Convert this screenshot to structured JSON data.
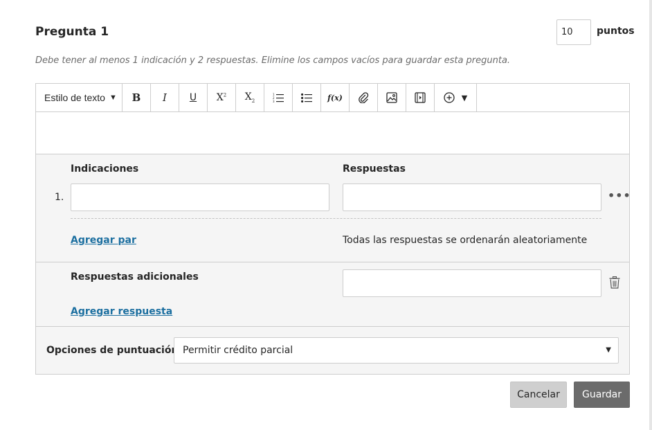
{
  "question": {
    "title": "Pregunta 1",
    "points_value": "10",
    "points_label": "puntos",
    "hint": "Debe tener al menos 1 indicación y 2 respuestas. Elimine los campos vacíos para guardar esta pregunta."
  },
  "toolbar": {
    "text_style": "Estilo de texto",
    "bold": "B",
    "italic": "I",
    "underline": "U",
    "superscript_base": "X",
    "subscript_base": "X",
    "formula": "f(x)"
  },
  "pairs": {
    "prompts_header": "Indicaciones",
    "answers_header": "Respuestas",
    "rows": [
      {
        "number": "1.",
        "prompt": "",
        "answer": ""
      }
    ],
    "add_pair": "Agregar par",
    "randomize_note": "Todas las respuestas se ordenarán aleatoriamente"
  },
  "additional": {
    "header": "Respuestas adicionales",
    "add_answer": "Agregar respuesta"
  },
  "scoring": {
    "label": "Opciones de puntuación",
    "selected": "Permitir crédito parcial"
  },
  "actions": {
    "cancel": "Cancelar",
    "save": "Guardar"
  },
  "colors": {
    "link": "#1c6fa0",
    "save_button": "#6b6b6b",
    "cancel_button": "#cfcfcf"
  }
}
